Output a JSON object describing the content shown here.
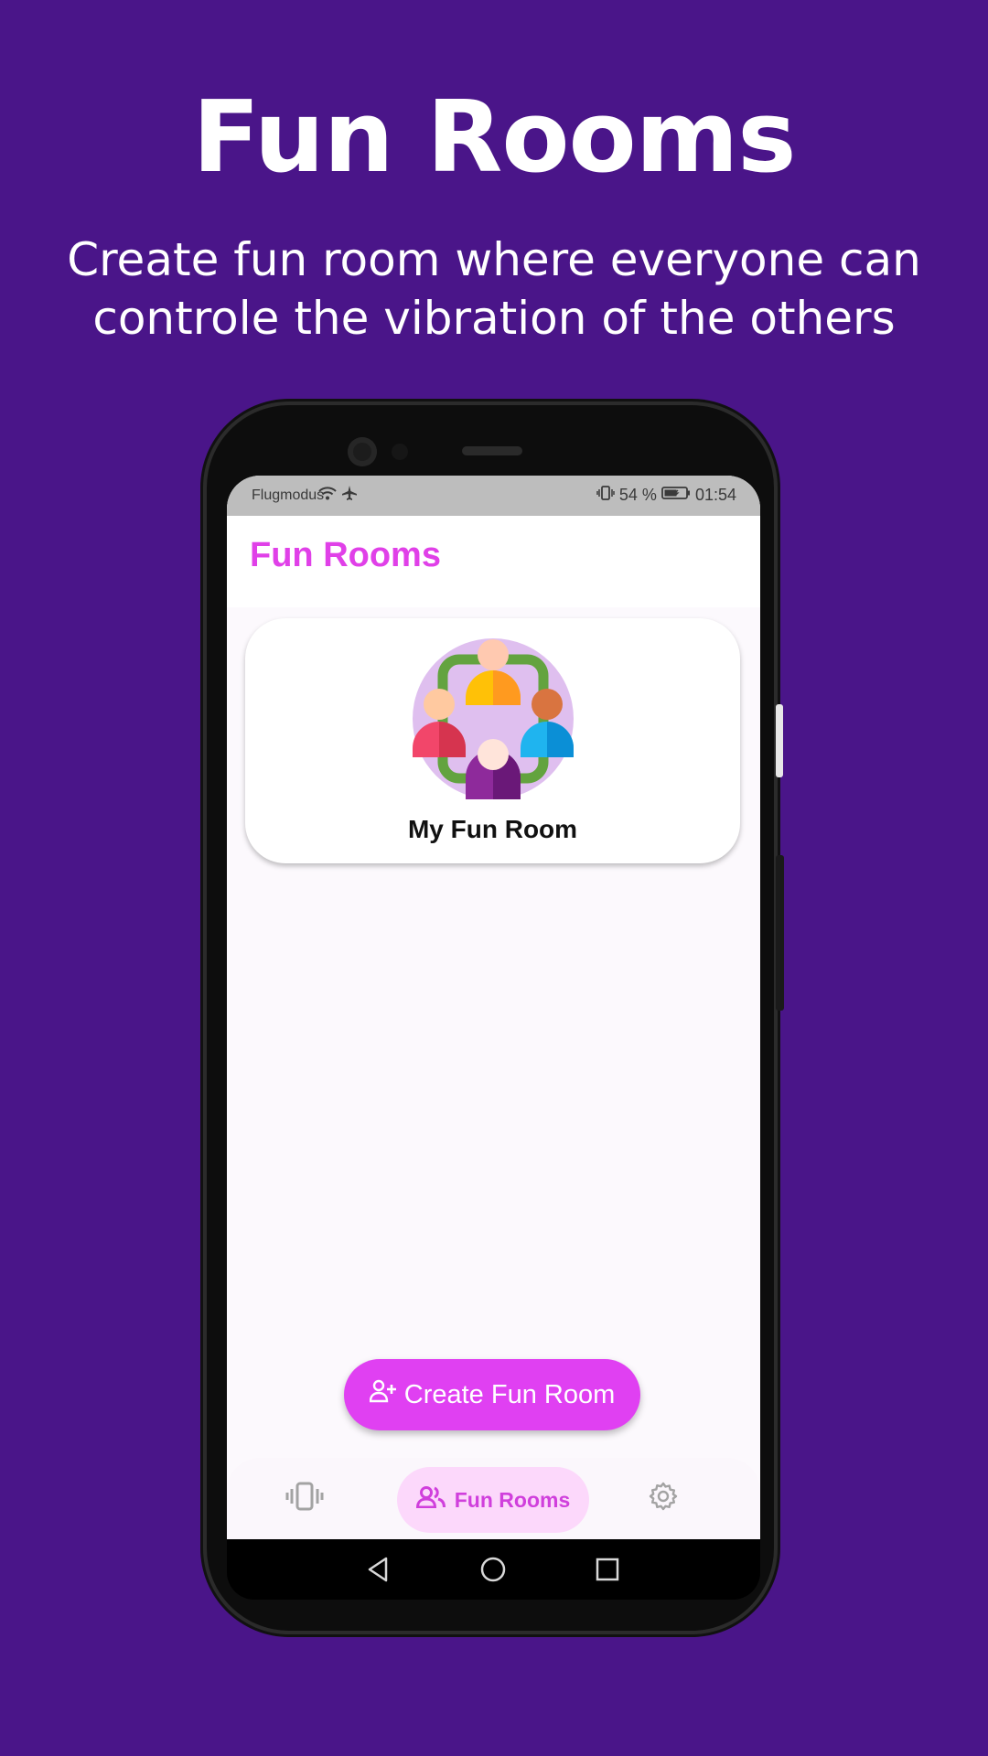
{
  "promo": {
    "title": "Fun Rooms",
    "subtitle_line1": "Create fun room where everyone can",
    "subtitle_line2": "controle the vibration of the others"
  },
  "status_bar": {
    "carrier": "Flugmodus",
    "battery": "54 %",
    "time": "01:54"
  },
  "app": {
    "title": "Fun Rooms",
    "rooms": [
      {
        "name": "My Fun Room",
        "icon": "group-circle-icon"
      }
    ],
    "fab_label": "Create Fun Room"
  },
  "bottom_nav": {
    "items": [
      {
        "icon": "vibrate-icon",
        "label": "",
        "active": false
      },
      {
        "icon": "people-icon",
        "label": "Fun Rooms",
        "active": true
      },
      {
        "icon": "gear-icon",
        "label": "",
        "active": false
      }
    ]
  },
  "colors": {
    "background": "#4a1589",
    "accent": "#e040f2",
    "nav_active_bg": "#fcd8fb"
  }
}
